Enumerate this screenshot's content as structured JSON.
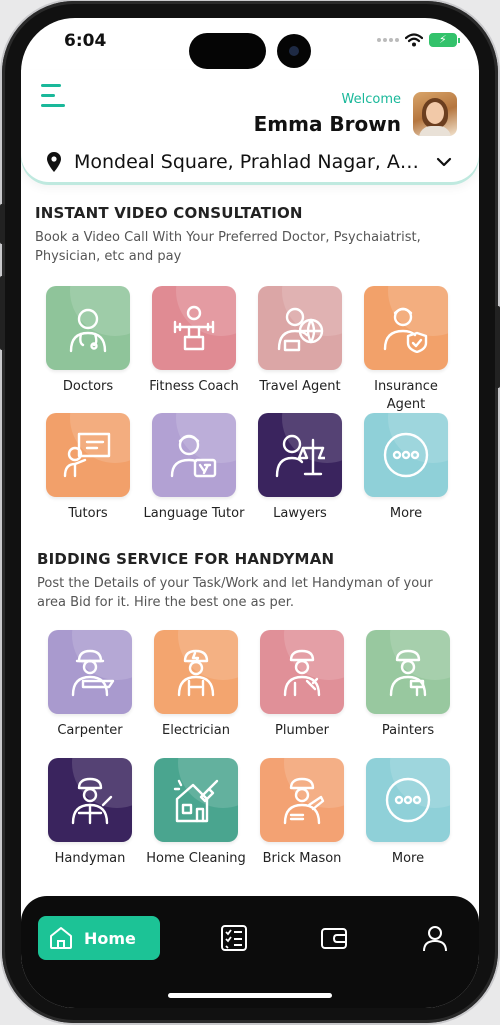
{
  "status_bar": {
    "time": "6:04"
  },
  "header": {
    "welcome": "Welcome",
    "user_name": "Emma Brown",
    "location": "Mondeal Square, Prahlad Nagar, Ahmedabad"
  },
  "consultation": {
    "title": "INSTANT VIDEO CONSULTATION",
    "description": "Book a Video Call With Your Preferred Doctor, Psychaiatrist, Physician, etc and pay",
    "items": [
      {
        "label": "Doctors",
        "icon": "doctor-icon",
        "color": "#8fc49a"
      },
      {
        "label": "Fitness Coach",
        "icon": "fitness-coach-icon",
        "color": "#e08b93"
      },
      {
        "label": "Travel Agent",
        "icon": "travel-agent-icon",
        "color": "#dba6a6"
      },
      {
        "label": "Insurance Agent",
        "icon": "insurance-agent-icon",
        "color": "#f2a16a"
      },
      {
        "label": "Tutors",
        "icon": "tutor-icon",
        "color": "#f2a06a"
      },
      {
        "label": "Language Tutor",
        "icon": "language-tutor-icon",
        "color": "#b2a1d3"
      },
      {
        "label": "Lawyers",
        "icon": "lawyer-icon",
        "color": "#3a245e"
      },
      {
        "label": "More",
        "icon": "more-icon",
        "color": "#8fd0d8"
      }
    ]
  },
  "handyman": {
    "title": "BIDDING SERVICE FOR HANDYMAN",
    "description": "Post the Details of your Task/Work and let Handyman of your area Bid for it. Hire the best one as per.",
    "items": [
      {
        "label": "Carpenter",
        "icon": "carpenter-icon",
        "color": "#a99ace"
      },
      {
        "label": "Electrician",
        "icon": "electrician-icon",
        "color": "#f3a56f"
      },
      {
        "label": "Plumber",
        "icon": "plumber-icon",
        "color": "#e09098"
      },
      {
        "label": "Painters",
        "icon": "painter-icon",
        "color": "#98c89f"
      },
      {
        "label": "Handyman",
        "icon": "handyman-icon",
        "color": "#3a245e"
      },
      {
        "label": "Home Cleaning",
        "icon": "home-cleaning-icon",
        "color": "#4aa58f"
      },
      {
        "label": "Brick Mason",
        "icon": "brick-mason-icon",
        "color": "#f3a273"
      },
      {
        "label": "More",
        "icon": "more-icon",
        "color": "#8fd0d8"
      }
    ]
  },
  "bottom_nav": {
    "home_label": "Home",
    "items": [
      "home-icon",
      "task-list-icon",
      "wallet-icon",
      "profile-icon"
    ],
    "accent": "#1cc396"
  }
}
